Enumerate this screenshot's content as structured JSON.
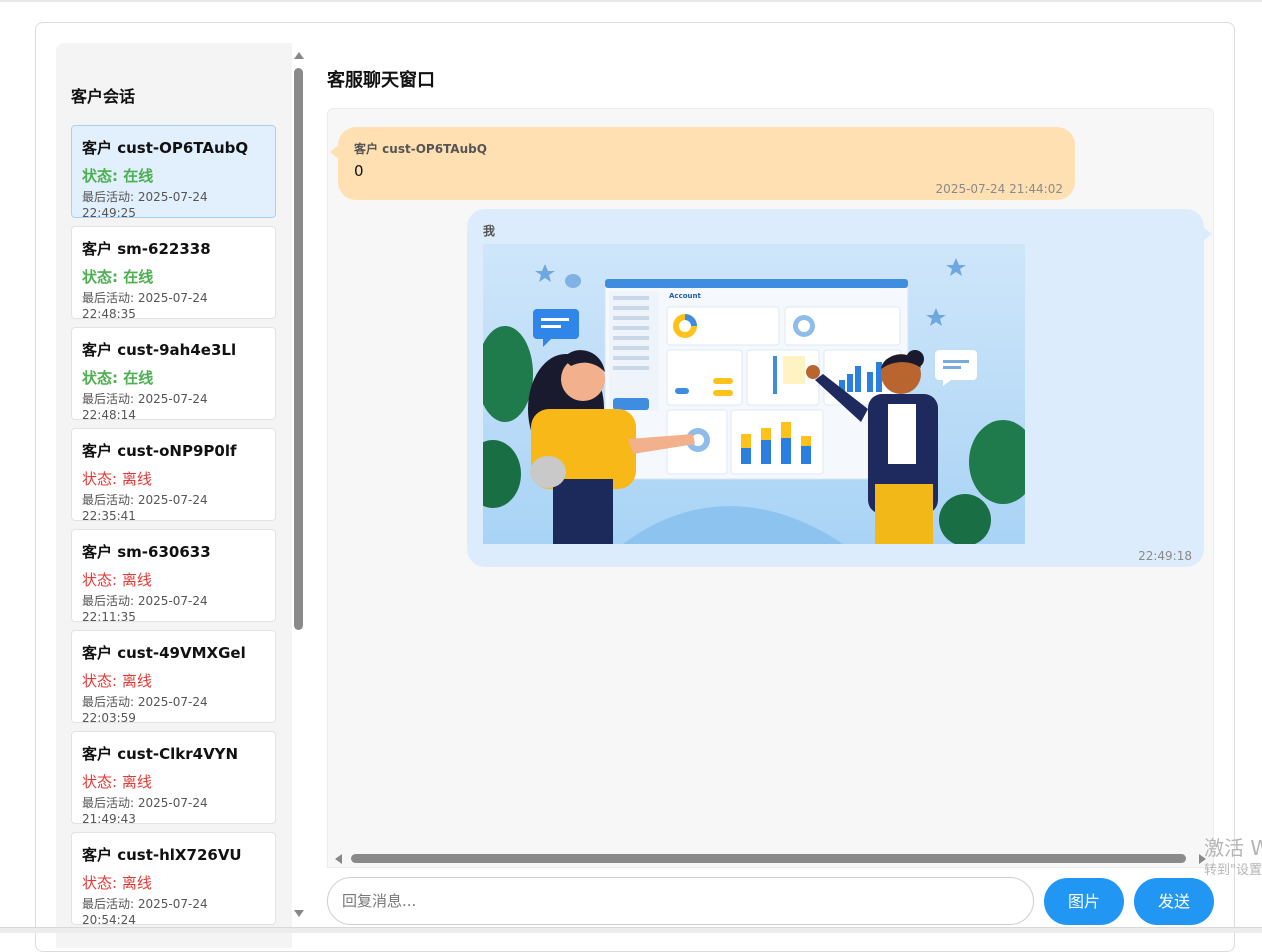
{
  "sidebar": {
    "title": "客户会话",
    "sessions": [
      {
        "name": "客户 cust-OP6TAubQ",
        "status": "状态: 在线",
        "last": "最后活动: 2025-07-24 22:49:25"
      },
      {
        "name": "客户 sm-622338",
        "status": "状态: 在线",
        "last": "最后活动: 2025-07-24 22:48:35"
      },
      {
        "name": "客户 cust-9ah4e3Ll",
        "status": "状态: 在线",
        "last": "最后活动: 2025-07-24 22:48:14"
      },
      {
        "name": "客户 cust-oNP9P0lf",
        "status": "状态: 离线",
        "last": "最后活动: 2025-07-24 22:35:41"
      },
      {
        "name": "客户 sm-630633",
        "status": "状态: 离线",
        "last": "最后活动: 2025-07-24 22:11:35"
      },
      {
        "name": "客户 cust-49VMXGel",
        "status": "状态: 离线",
        "last": "最后活动: 2025-07-24 22:03:59"
      },
      {
        "name": "客户 cust-Clkr4VYN",
        "status": "状态: 离线",
        "last": "最后活动: 2025-07-24 21:49:43"
      },
      {
        "name": "客户 cust-hlX726VU",
        "status": "状态: 离线",
        "last": "最后活动: 2025-07-24 20:54:24"
      }
    ]
  },
  "chat": {
    "title": "客服聊天窗口",
    "messages": [
      {
        "sender": "客户 cust-OP6TAubQ",
        "text": "0",
        "time": "2025-07-24 21:44:02"
      },
      {
        "sender": "我",
        "image": "dashboard-illustration",
        "time": "22:49:18"
      }
    ],
    "image_text": {
      "brand": "Account"
    }
  },
  "input": {
    "placeholder": "回复消息..."
  },
  "buttons": {
    "image": "图片",
    "send": "发送"
  },
  "watermark": {
    "line1": "激活 W",
    "line2": "转到\"设置"
  },
  "colors": {
    "online": "#4caf50",
    "offline": "#e53935",
    "accent": "#2196f3",
    "incoming": "#ffe0b2",
    "outgoing": "#dcecfc",
    "active_card": "#e2f0fd"
  }
}
